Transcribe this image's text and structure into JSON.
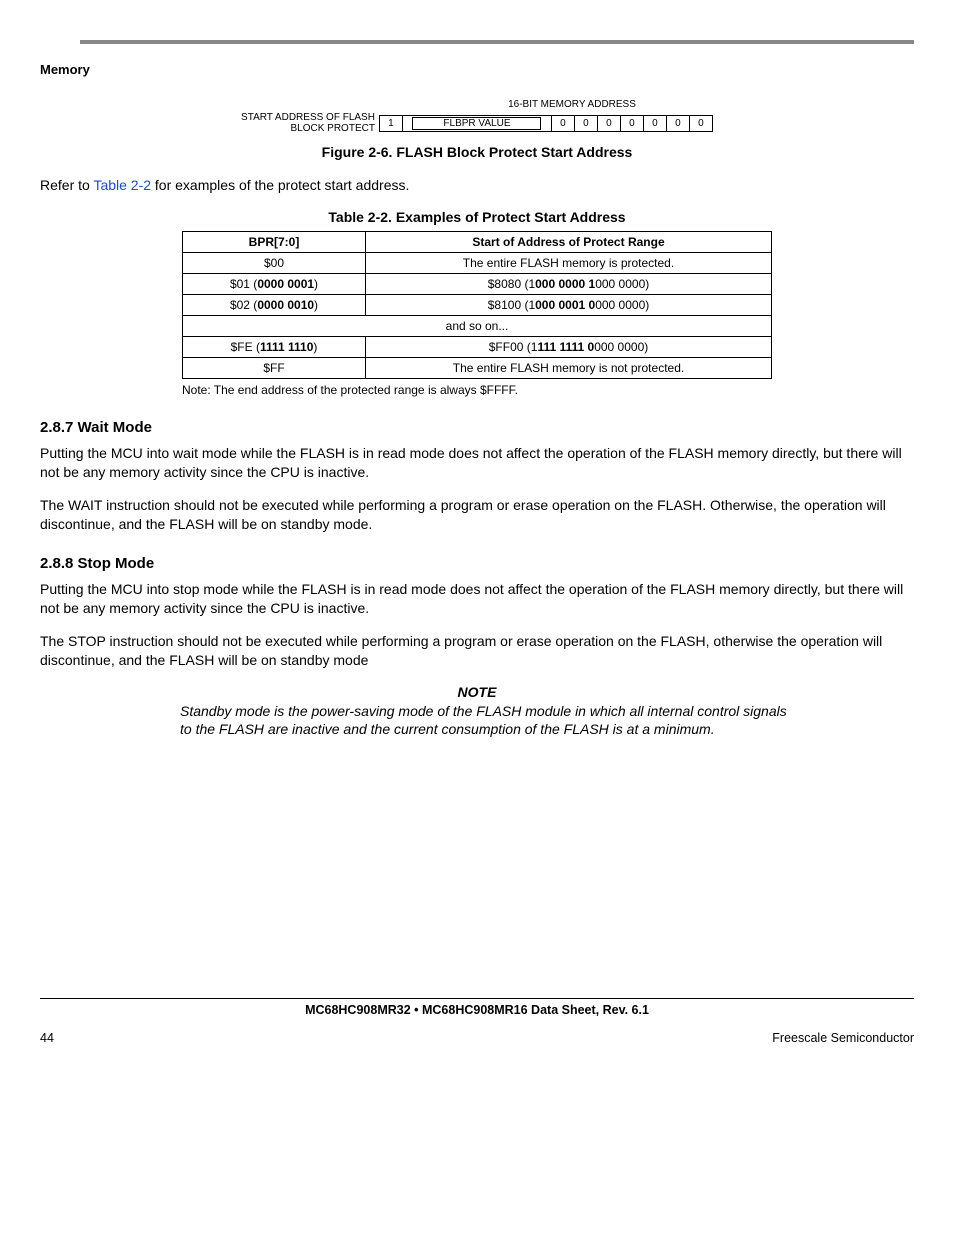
{
  "header": {
    "section": "Memory"
  },
  "fig26": {
    "top_label": "16-BIT MEMORY ADDRESS",
    "left_label_1": "START ADDRESS OF FLASH",
    "left_label_2": "BLOCK PROTECT",
    "bit15": "1",
    "mid_label": "FLBPR VALUE",
    "zeros": [
      "0",
      "0",
      "0",
      "0",
      "0",
      "0",
      "0"
    ],
    "caption": "Figure 2-6. FLASH Block Protect Start Address"
  },
  "intro": {
    "pre": "Refer to ",
    "link": "Table 2-2",
    "post": " for examples of the protect start address."
  },
  "table22": {
    "caption": "Table 2-2. Examples of Protect Start Address",
    "head_a": "BPR[7:0]",
    "head_b": "Start of Address of Protect Range",
    "rows": [
      {
        "a_pre": "",
        "a_hex": "$00",
        "a_bin": "",
        "b_pre": "",
        "b_txt": "The entire FLASH memory is protected.",
        "b_bin_pre": "",
        "b_bin_bold": "",
        "b_bin_post": ""
      },
      {
        "a_pre": "$01 (",
        "a_bold": "0000 0001",
        "a_post": ")",
        "b_pre": "$8080 (1",
        "b_bold": "000 0000 1",
        "b_post": "000 0000)"
      },
      {
        "a_pre": "$02 (",
        "a_bold": "0000 0010",
        "a_post": ")",
        "b_pre": "$8100 (1",
        "b_bold": "000 0001 0",
        "b_post": "000 0000)"
      },
      {
        "span": "and so on..."
      },
      {
        "a_pre": "$FE (",
        "a_bold": "1111 1110",
        "a_post": ")",
        "b_pre": "$FF00 (1",
        "b_bold": "111 1111 0",
        "b_post": "000 0000)"
      },
      {
        "a_pre": "",
        "a_hex": "$FF",
        "a_bin": "",
        "b_txt": "The entire FLASH memory is not protected."
      }
    ],
    "note": "Note: The end address of the protected range is always $FFFF."
  },
  "sec287": {
    "title": "2.8.7  Wait Mode",
    "p1": "Putting the MCU into wait mode while the FLASH is in read mode does not affect the operation of the FLASH memory directly, but there will not be any memory activity since the CPU is inactive.",
    "p2": "The WAIT instruction should not be executed while performing a program or erase operation on the FLASH. Otherwise, the operation will discontinue, and the FLASH will be on standby mode."
  },
  "sec288": {
    "title": "2.8.8  Stop Mode",
    "p1": "Putting the MCU into stop mode while the FLASH is in read mode does not affect the operation of the FLASH memory directly, but there will not be any memory activity since the CPU is inactive.",
    "p2": "The STOP instruction should not be executed while performing a program or erase operation on the FLASH, otherwise the operation will discontinue, and the FLASH will be on standby mode"
  },
  "note": {
    "head": "NOTE",
    "body": "Standby mode is the power-saving mode of the FLASH module in which all internal control signals to the FLASH are inactive and the current consumption of the FLASH is at a minimum."
  },
  "footer": {
    "doc": "MC68HC908MR32 • MC68HC908MR16 Data Sheet, Rev. 6.1",
    "page": "44",
    "vendor": "Freescale Semiconductor"
  }
}
